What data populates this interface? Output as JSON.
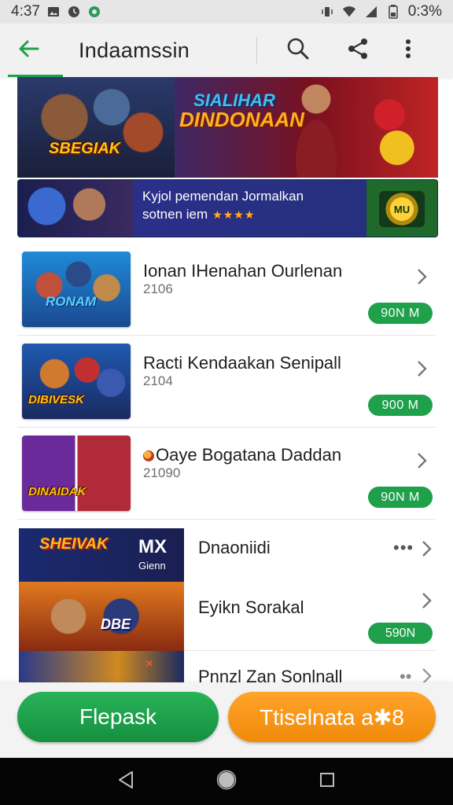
{
  "status_bar": {
    "time": "4:37",
    "battery_text": "0:3%",
    "icons": [
      "image-icon",
      "clock-icon",
      "app-icon",
      "vibrate-icon",
      "wifi-icon",
      "signal-icon",
      "battery-icon"
    ]
  },
  "app_bar": {
    "title": "Indaamssin",
    "icons": [
      "back-arrow-icon",
      "search-icon",
      "share-icon",
      "more-vert-icon"
    ]
  },
  "hero_banner": {
    "title_line1": "SIALIHAR",
    "title_line2": "DINDONAAN",
    "logo": "SBEGIAK"
  },
  "promo_banner": {
    "line1": "Kyjol pemendan Jormalkan",
    "line2": "sotnen iem",
    "stars": "★★★★",
    "badge": "MU"
  },
  "list": [
    {
      "title": "Ionan IHenahan Ourlenan",
      "subtitle": "2106",
      "price": "90N M",
      "thumb_label": "RONAM"
    },
    {
      "title": "Racti Kendaakan Senipall",
      "subtitle": "2104",
      "price": "900 M",
      "thumb_label": "DIBIVESK"
    },
    {
      "title": "Oaye Bogatana Daddan",
      "subtitle": "21090",
      "price": "90N M",
      "thumb_label": "DINAIDAK"
    }
  ],
  "featured": {
    "logo": "SHEIVAK",
    "mx_label": "MX",
    "mx_sub": "Gienn",
    "logo2": "DBE",
    "items": [
      {
        "title": "Dnaoniidi",
        "more": "•••"
      },
      {
        "title": "Eyikn Sorakal",
        "price": "590N"
      },
      {
        "title": "Pnnzl Zan Sonlnall",
        "more": "••"
      }
    ]
  },
  "actions": {
    "primary_label": "Flepask",
    "secondary_label": "Ttiselnata a✱8"
  },
  "colors": {
    "accent_green": "#1fa04a",
    "accent_orange": "#f59a14",
    "nav_bg": "#050505"
  }
}
